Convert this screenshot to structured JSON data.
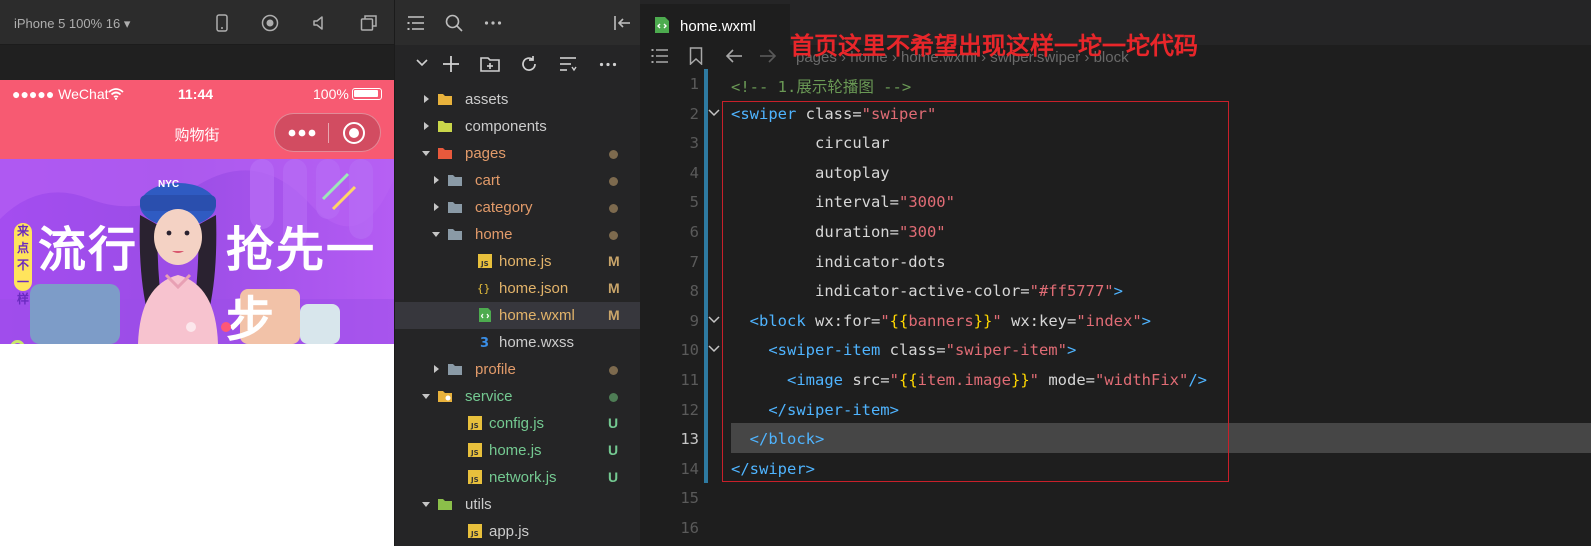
{
  "simulator": {
    "device_label": "iPhone 5 100% 16 ▾",
    "status": {
      "carrier": "●●●●● WeChat",
      "time": "11:44",
      "battery": "100%"
    },
    "nav_title": "购物街",
    "banner": {
      "side_tag": "来点不一样",
      "text_left": "流行",
      "text_right": "抢先一步",
      "hat_text": "NYC"
    }
  },
  "explorer": {
    "items": [
      {
        "label": "assets",
        "type": "folder",
        "indent": 0,
        "expanded": false,
        "icon_color": "#e8b23c",
        "status": ""
      },
      {
        "label": "components",
        "type": "folder",
        "indent": 0,
        "expanded": false,
        "icon_color": "#c9d64a",
        "status": ""
      },
      {
        "label": "pages",
        "type": "folder",
        "indent": 0,
        "expanded": true,
        "icon_color": "#e8593c",
        "status": "dot",
        "text_color": "#e29b6a"
      },
      {
        "label": "cart",
        "type": "folder",
        "indent": 1,
        "expanded": false,
        "icon_color": "#8a9aa6",
        "status": "dot",
        "text_color": "#e29b6a"
      },
      {
        "label": "category",
        "type": "folder",
        "indent": 1,
        "expanded": false,
        "icon_color": "#8a9aa6",
        "status": "dot",
        "text_color": "#e29b6a"
      },
      {
        "label": "home",
        "type": "folder",
        "indent": 1,
        "expanded": true,
        "icon_color": "#8a9aa6",
        "status": "dot",
        "text_color": "#e29b6a"
      },
      {
        "label": "home.js",
        "type": "js",
        "indent": 2,
        "status": "M",
        "text_color": "#e2b36a"
      },
      {
        "label": "home.json",
        "type": "json",
        "indent": 2,
        "status": "M",
        "text_color": "#e2b36a"
      },
      {
        "label": "home.wxml",
        "type": "wxml",
        "indent": 2,
        "status": "M",
        "text_color": "#e2b36a",
        "selected": true
      },
      {
        "label": "home.wxss",
        "type": "wxss",
        "indent": 2,
        "status": "",
        "text_color": "#cccccc"
      },
      {
        "label": "profile",
        "type": "folder",
        "indent": 1,
        "expanded": false,
        "icon_color": "#8a9aa6",
        "status": "dot",
        "text_color": "#e29b6a"
      },
      {
        "label": "service",
        "type": "folder-gear",
        "indent": 0,
        "expanded": true,
        "icon_color": "#e8b23c",
        "status": "dotg",
        "text_color": "#74c991"
      },
      {
        "label": "config.js",
        "type": "js",
        "indent": 1,
        "status": "U",
        "text_color": "#74c991"
      },
      {
        "label": "home.js",
        "type": "js",
        "indent": 1,
        "status": "U",
        "text_color": "#74c991"
      },
      {
        "label": "network.js",
        "type": "js",
        "indent": 1,
        "status": "U",
        "text_color": "#74c991"
      },
      {
        "label": "utils",
        "type": "folder",
        "indent": 0,
        "expanded": true,
        "icon_color": "#8bbf4a",
        "status": "",
        "text_color": "#cccccc"
      },
      {
        "label": "app.js",
        "type": "js",
        "indent": 1,
        "status": "",
        "text_color": "#cccccc"
      }
    ]
  },
  "editor": {
    "tab_label": "home.wxml",
    "breadcrumb": "pages › home › home.wxml › swiper.swiper › block",
    "annotation": "首页这里不希望出现这样一坨一坨代码",
    "current_line": 13,
    "lines": [
      {
        "n": "1",
        "tokens": [
          [
            "c-comment",
            "<!-- 1.展示轮播图 -->"
          ]
        ]
      },
      {
        "n": "2",
        "fold": true,
        "tokens": [
          [
            "c-tag",
            "<swiper"
          ],
          [
            "c-attr",
            " class="
          ],
          [
            "c-str",
            "\"swiper\""
          ]
        ]
      },
      {
        "n": "3",
        "tokens": [
          [
            "c-attr",
            "         circular"
          ]
        ]
      },
      {
        "n": "4",
        "tokens": [
          [
            "c-attr",
            "         autoplay"
          ]
        ]
      },
      {
        "n": "5",
        "tokens": [
          [
            "c-attr",
            "         interval="
          ],
          [
            "c-str",
            "\"3000\""
          ]
        ]
      },
      {
        "n": "6",
        "tokens": [
          [
            "c-attr",
            "         duration="
          ],
          [
            "c-str",
            "\"300\""
          ]
        ]
      },
      {
        "n": "7",
        "tokens": [
          [
            "c-attr",
            "         indicator-dots"
          ]
        ]
      },
      {
        "n": "8",
        "tokens": [
          [
            "c-attr",
            "         indicator-active-color="
          ],
          [
            "c-str",
            "\"#ff5777\""
          ],
          [
            "c-tag",
            ">"
          ]
        ]
      },
      {
        "n": "9",
        "fold": true,
        "tokens": [
          [
            "c-tag",
            "  <block"
          ],
          [
            "c-attr",
            " wx:for="
          ],
          [
            "c-str",
            "\""
          ],
          [
            "c-brace",
            "{{"
          ],
          [
            "c-ident",
            "banners"
          ],
          [
            "c-brace",
            "}}"
          ],
          [
            "c-str",
            "\""
          ],
          [
            "c-attr",
            " wx:key="
          ],
          [
            "c-str",
            "\"index\""
          ],
          [
            "c-tag",
            ">"
          ]
        ]
      },
      {
        "n": "10",
        "fold": true,
        "tokens": [
          [
            "c-tag",
            "    <swiper-item"
          ],
          [
            "c-attr",
            " class="
          ],
          [
            "c-str",
            "\"swiper-item\""
          ],
          [
            "c-tag",
            ">"
          ]
        ]
      },
      {
        "n": "11",
        "tokens": [
          [
            "c-tag",
            "      <image"
          ],
          [
            "c-attr",
            " src="
          ],
          [
            "c-str",
            "\""
          ],
          [
            "c-brace",
            "{{"
          ],
          [
            "c-ident",
            "item.image"
          ],
          [
            "c-brace",
            "}}"
          ],
          [
            "c-str",
            "\""
          ],
          [
            "c-attr",
            " mode="
          ],
          [
            "c-str",
            "\"widthFix\""
          ],
          [
            "c-tag",
            "/>"
          ]
        ]
      },
      {
        "n": "12",
        "tokens": [
          [
            "c-tag",
            "    </swiper-item>"
          ]
        ]
      },
      {
        "n": "13",
        "tokens": [
          [
            "c-tag",
            "  </block>"
          ]
        ]
      },
      {
        "n": "14",
        "tokens": [
          [
            "c-tag",
            "</swiper>"
          ]
        ]
      },
      {
        "n": "15",
        "tokens": []
      },
      {
        "n": "16",
        "tokens": []
      }
    ]
  }
}
